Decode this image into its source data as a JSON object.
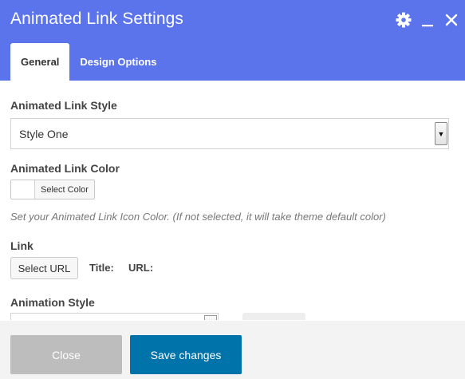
{
  "dialog": {
    "title": "Animated Link Settings",
    "header_color": "#5b73eb",
    "icons": [
      "gear-icon",
      "minimize-icon",
      "close-icon"
    ],
    "tabs": [
      {
        "label": "General",
        "active": true
      },
      {
        "label": "Design Options",
        "active": false
      }
    ]
  },
  "form": {
    "style_label": "Animated Link Style",
    "style_value": "Style One",
    "color_label": "Animated Link Color",
    "color_button": "Select Color",
    "color_help": "Set your Animated Link Icon Color. (If not selected, it will take theme default color)",
    "link_label": "Link",
    "link_button": "Select URL",
    "link_title_label": "Title:",
    "link_url_label": "URL:",
    "animation_label": "Animation Style"
  },
  "footer": {
    "close_label": "Close",
    "save_label": "Save changes",
    "save_color": "#0073aa"
  }
}
